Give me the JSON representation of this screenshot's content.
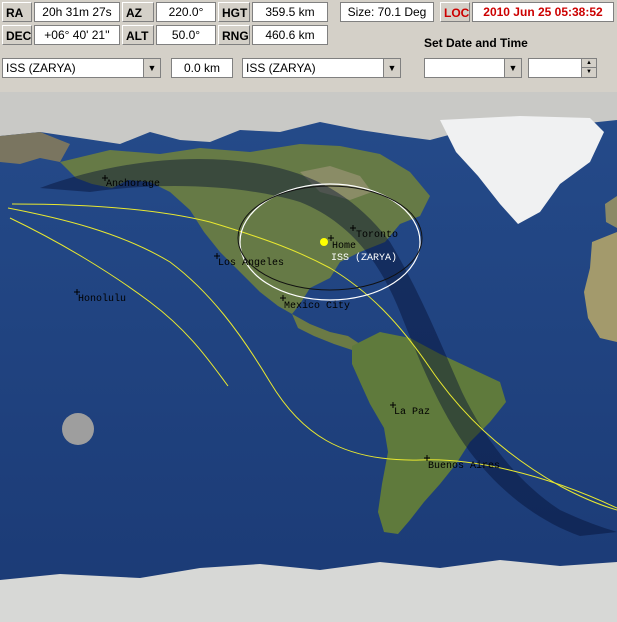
{
  "readouts": {
    "ra_label": "RA",
    "ra_value": "20h 31m 27s",
    "dec_label": "DEC",
    "dec_value": "+06° 40' 21''",
    "az_label": "AZ",
    "az_value": "220.0°",
    "alt_label": "ALT",
    "alt_value": "50.0°",
    "hgt_label": "HGT",
    "hgt_value": "359.5 km",
    "rng_label": "RNG",
    "rng_value": "460.6 km",
    "size_value": "Size: 70.1 Deg",
    "loc_label": "LOC",
    "datetime_value": "2010 Jun 25   05:38:52"
  },
  "controls": {
    "sat_select_1": "ISS (ZARYA)",
    "distance_value": "0.0 km",
    "sat_select_2": "ISS (ZARYA)",
    "set_date_time_label": "Set  Date and Time",
    "date_select": "",
    "time_spin": ""
  },
  "map": {
    "cities": {
      "anchorage": "Anchorage",
      "honolulu": "Honolulu",
      "los_angeles": "Los Angeles",
      "mexico_city": "Mexico City",
      "toronto": "Toronto",
      "home": "Home",
      "la_paz": "La Paz",
      "buenos_aires": "Buenos Aires"
    },
    "satellite_label": "ISS (ZARYA)",
    "colors": {
      "ocean": "#1d3f7e",
      "orbit": "#e8e830",
      "footprint": "#ffffff",
      "satellite": "#ffff00"
    }
  }
}
